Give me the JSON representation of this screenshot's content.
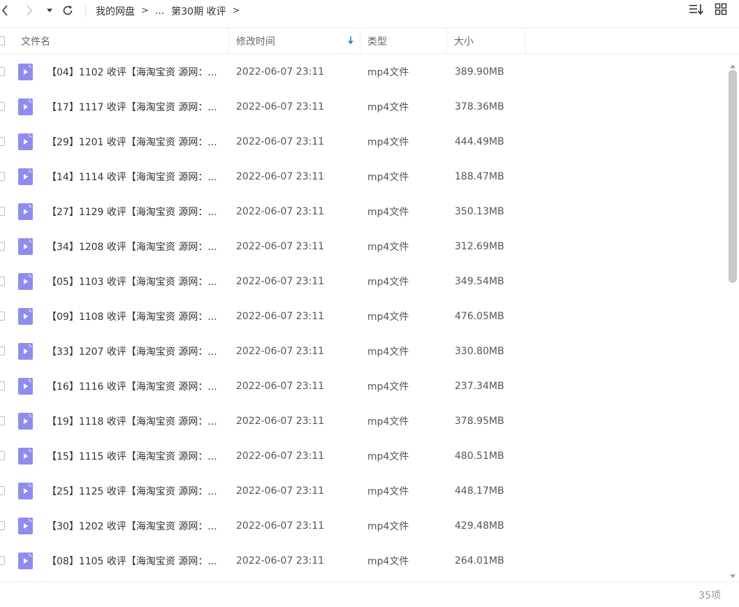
{
  "toolbar": {
    "breadcrumb": {
      "root": "我的网盘",
      "sep1": ">",
      "ellipsis": "...",
      "current": "第30期 收评",
      "sep2": ">"
    },
    "icons": {
      "back": "chevron-left-icon",
      "forward": "chevron-right-icon",
      "history": "caret-down-icon",
      "refresh": "refresh-icon",
      "sort": "sort-list-icon",
      "grid": "grid-view-icon"
    }
  },
  "header": {
    "name": "文件名",
    "modified": "修改时间",
    "type": "类型",
    "size": "大小"
  },
  "colors": {
    "file_icon": "#8f8cf0",
    "sort_arrow": "#1e88e5"
  },
  "files": [
    {
      "name": "【04】1102 收评【海淘宝资 源网：...",
      "modified": "2022-06-07 23:11",
      "type": "mp4文件",
      "size": "389.90MB"
    },
    {
      "name": "【17】1117 收评【海淘宝资 源网：...",
      "modified": "2022-06-07 23:11",
      "type": "mp4文件",
      "size": "378.36MB"
    },
    {
      "name": "【29】1201 收评【海淘宝资 源网：...",
      "modified": "2022-06-07 23:11",
      "type": "mp4文件",
      "size": "444.49MB"
    },
    {
      "name": "【14】1114 收评【海淘宝资 源网：...",
      "modified": "2022-06-07 23:11",
      "type": "mp4文件",
      "size": "188.47MB"
    },
    {
      "name": "【27】1129 收评【海淘宝资 源网：...",
      "modified": "2022-06-07 23:11",
      "type": "mp4文件",
      "size": "350.13MB"
    },
    {
      "name": "【34】1208 收评【海淘宝资 源网：...",
      "modified": "2022-06-07 23:11",
      "type": "mp4文件",
      "size": "312.69MB"
    },
    {
      "name": "【05】1103 收评【海淘宝资 源网：...",
      "modified": "2022-06-07 23:11",
      "type": "mp4文件",
      "size": "349.54MB"
    },
    {
      "name": "【09】1108 收评【海淘宝资 源网：...",
      "modified": "2022-06-07 23:11",
      "type": "mp4文件",
      "size": "476.05MB"
    },
    {
      "name": "【33】1207 收评【海淘宝资 源网：...",
      "modified": "2022-06-07 23:11",
      "type": "mp4文件",
      "size": "330.80MB"
    },
    {
      "name": "【16】1116 收评【海淘宝资 源网：...",
      "modified": "2022-06-07 23:11",
      "type": "mp4文件",
      "size": "237.34MB"
    },
    {
      "name": "【19】1118 收评【海淘宝资 源网：...",
      "modified": "2022-06-07 23:11",
      "type": "mp4文件",
      "size": "378.95MB"
    },
    {
      "name": "【15】1115 收评【海淘宝资 源网：...",
      "modified": "2022-06-07 23:11",
      "type": "mp4文件",
      "size": "480.51MB"
    },
    {
      "name": "【25】1125 收评【海淘宝资 源网：...",
      "modified": "2022-06-07 23:11",
      "type": "mp4文件",
      "size": "448.17MB"
    },
    {
      "name": "【30】1202 收评【海淘宝资 源网：...",
      "modified": "2022-06-07 23:11",
      "type": "mp4文件",
      "size": "429.48MB"
    },
    {
      "name": "【08】1105 收评【海淘宝资 源网：...",
      "modified": "2022-06-07 23:11",
      "type": "mp4文件",
      "size": "264.01MB"
    }
  ],
  "footer": {
    "count": "35项"
  }
}
